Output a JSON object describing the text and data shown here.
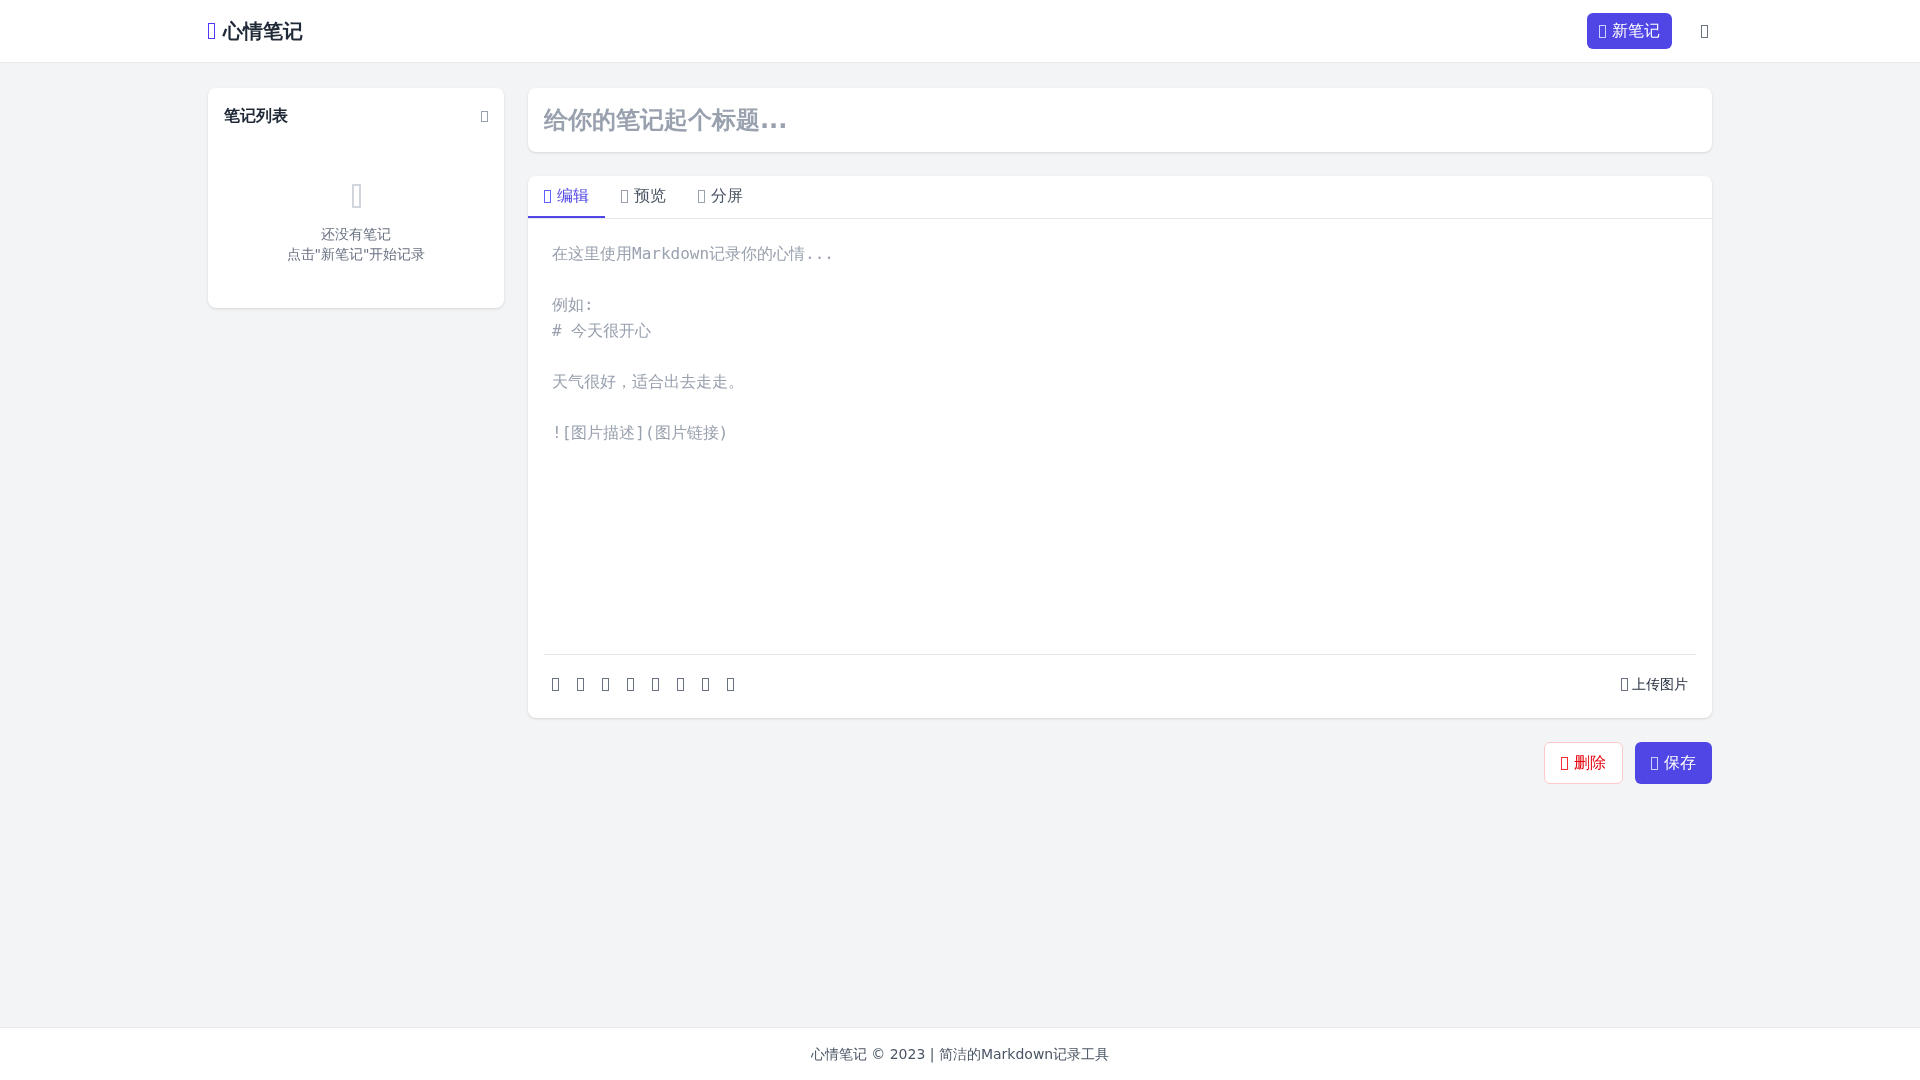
{
  "header": {
    "brand": "心情笔记",
    "new_button": "新笔记"
  },
  "sidebar": {
    "title": "笔记列表",
    "empty": [
      "还没有笔记",
      "点击\"新笔记\"开始记录"
    ]
  },
  "editor": {
    "title_placeholder": "给你的笔记起个标题...",
    "tabs": [
      {
        "label": "编辑",
        "selected": true
      },
      {
        "label": "预览",
        "selected": false
      },
      {
        "label": "分屏",
        "selected": false
      }
    ],
    "body_placeholder": [
      [
        "在这里使用Markdown记录你的心情..."
      ],
      [
        "例如:",
        "# 今天很开心"
      ],
      [
        "天气很好，适合出去走走。"
      ],
      [
        "![图片描述](图片链接)"
      ]
    ],
    "upload": "上传图片"
  },
  "actions": [
    {
      "kind": "danger",
      "label": "删除"
    },
    {
      "kind": "primary",
      "label": "保存"
    }
  ],
  "footer": "心情笔记 © 2023 | 简洁的Markdown记录工具"
}
